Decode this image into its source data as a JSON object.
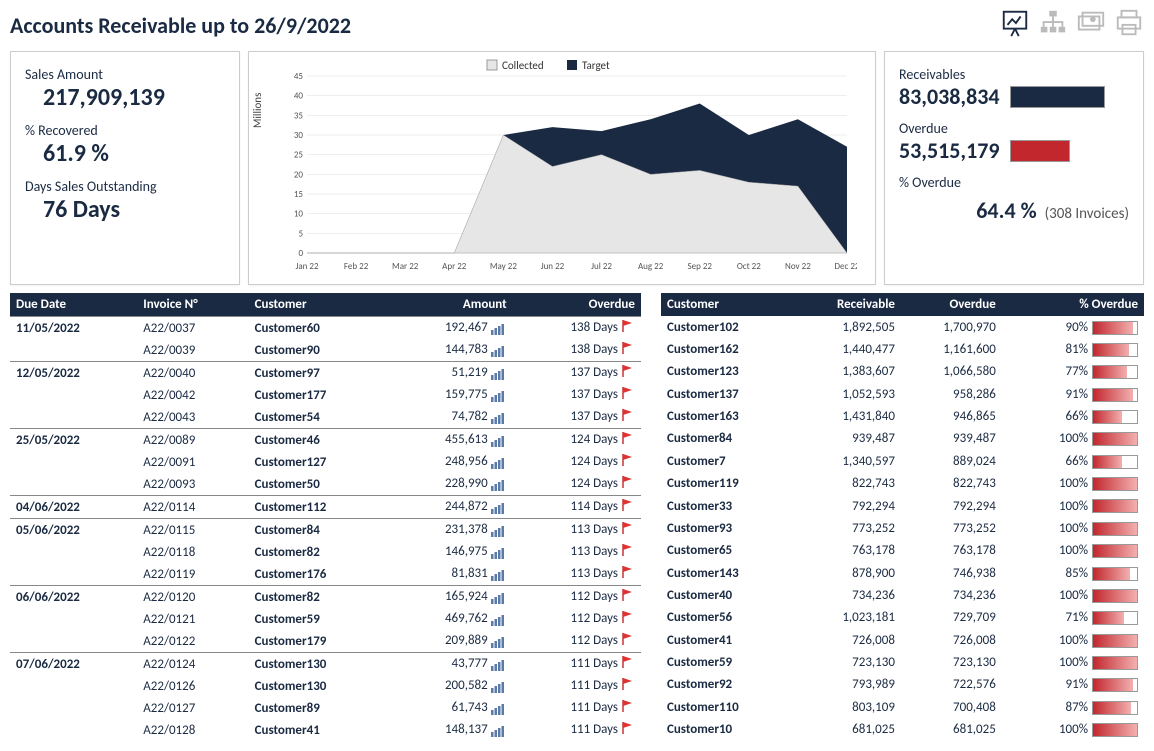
{
  "title": "Accounts Receivable up to 26/9/2022",
  "kpi_left": {
    "sales_label": "Sales Amount",
    "sales_value": "217,909,139",
    "recovered_label": "% Recovered",
    "recovered_value": "61.9 %",
    "dso_label": "Days Sales Outstanding",
    "dso_value": "76 Days"
  },
  "kpi_right": {
    "recv_label": "Receivables",
    "recv_value": "83,038,834",
    "overdue_label": "Overdue",
    "overdue_value": "53,515,179",
    "pct_overdue_label": "% Overdue",
    "pct_overdue_value": "64.4 %",
    "invoices_note": "(308 Invoices)"
  },
  "chart_data": {
    "type": "area",
    "title": "",
    "ylabel": "Millions",
    "xlabel": "",
    "ylim": [
      0,
      45
    ],
    "yticks": [
      0,
      5,
      10,
      15,
      20,
      25,
      30,
      35,
      40,
      45
    ],
    "categories": [
      "Jan 22",
      "Feb 22",
      "Mar 22",
      "Apr 22",
      "May 22",
      "Jun 22",
      "Jul 22",
      "Aug 22",
      "Sep 22",
      "Oct 22",
      "Nov 22",
      "Dec 22"
    ],
    "series": [
      {
        "name": "Collected",
        "color": "#e6e6e6",
        "values": [
          0,
          0,
          0,
          0,
          30,
          22,
          25,
          20,
          21,
          18,
          17,
          0
        ]
      },
      {
        "name": "Target",
        "color": "#1a2a42",
        "values": [
          0,
          0,
          0,
          0,
          30,
          32,
          31,
          34,
          38,
          30,
          34,
          27,
          0
        ]
      }
    ],
    "legend": [
      "Collected",
      "Target"
    ]
  },
  "invoice_table": {
    "headers": [
      "Due Date",
      "Invoice N°",
      "Customer",
      "Amount",
      "Overdue"
    ],
    "rows": [
      {
        "due": "11/05/2022",
        "inv": "A22/0037",
        "cust": "Customer60",
        "amt": "192,467",
        "days": "138 Days",
        "first": true
      },
      {
        "due": "",
        "inv": "A22/0039",
        "cust": "Customer90",
        "amt": "144,783",
        "days": "138 Days"
      },
      {
        "due": "12/05/2022",
        "inv": "A22/0040",
        "cust": "Customer97",
        "amt": "51,219",
        "days": "137 Days",
        "first": true
      },
      {
        "due": "",
        "inv": "A22/0042",
        "cust": "Customer177",
        "amt": "159,775",
        "days": "137 Days"
      },
      {
        "due": "",
        "inv": "A22/0043",
        "cust": "Customer54",
        "amt": "74,782",
        "days": "137 Days"
      },
      {
        "due": "25/05/2022",
        "inv": "A22/0089",
        "cust": "Customer46",
        "amt": "455,613",
        "days": "124 Days",
        "first": true
      },
      {
        "due": "",
        "inv": "A22/0091",
        "cust": "Customer127",
        "amt": "248,956",
        "days": "124 Days"
      },
      {
        "due": "",
        "inv": "A22/0093",
        "cust": "Customer50",
        "amt": "228,990",
        "days": "124 Days"
      },
      {
        "due": "04/06/2022",
        "inv": "A22/0114",
        "cust": "Customer112",
        "amt": "244,872",
        "days": "114 Days",
        "first": true
      },
      {
        "due": "05/06/2022",
        "inv": "A22/0115",
        "cust": "Customer84",
        "amt": "231,378",
        "days": "113 Days",
        "first": true
      },
      {
        "due": "",
        "inv": "A22/0118",
        "cust": "Customer82",
        "amt": "146,975",
        "days": "113 Days"
      },
      {
        "due": "",
        "inv": "A22/0119",
        "cust": "Customer176",
        "amt": "81,831",
        "days": "113 Days"
      },
      {
        "due": "06/06/2022",
        "inv": "A22/0120",
        "cust": "Customer82",
        "amt": "165,924",
        "days": "112 Days",
        "first": true
      },
      {
        "due": "",
        "inv": "A22/0121",
        "cust": "Customer59",
        "amt": "469,762",
        "days": "112 Days"
      },
      {
        "due": "",
        "inv": "A22/0122",
        "cust": "Customer179",
        "amt": "209,889",
        "days": "112 Days"
      },
      {
        "due": "07/06/2022",
        "inv": "A22/0124",
        "cust": "Customer130",
        "amt": "43,777",
        "days": "111 Days",
        "first": true
      },
      {
        "due": "",
        "inv": "A22/0126",
        "cust": "Customer130",
        "amt": "200,582",
        "days": "111 Days"
      },
      {
        "due": "",
        "inv": "A22/0127",
        "cust": "Customer89",
        "amt": "61,743",
        "days": "111 Days"
      },
      {
        "due": "",
        "inv": "A22/0128",
        "cust": "Customer41",
        "amt": "148,137",
        "days": "111 Days"
      }
    ]
  },
  "customer_table": {
    "headers": [
      "Customer",
      "Receivable",
      "Overdue",
      "% Overdue"
    ],
    "rows": [
      {
        "cust": "Customer102",
        "recv": "1,892,505",
        "over": "1,700,970",
        "pct": 90
      },
      {
        "cust": "Customer162",
        "recv": "1,440,477",
        "over": "1,161,600",
        "pct": 81
      },
      {
        "cust": "Customer123",
        "recv": "1,383,607",
        "over": "1,066,580",
        "pct": 77
      },
      {
        "cust": "Customer137",
        "recv": "1,052,593",
        "over": "958,286",
        "pct": 91
      },
      {
        "cust": "Customer163",
        "recv": "1,431,840",
        "over": "946,865",
        "pct": 66
      },
      {
        "cust": "Customer84",
        "recv": "939,487",
        "over": "939,487",
        "pct": 100
      },
      {
        "cust": "Customer7",
        "recv": "1,340,597",
        "over": "889,024",
        "pct": 66
      },
      {
        "cust": "Customer119",
        "recv": "822,743",
        "over": "822,743",
        "pct": 100
      },
      {
        "cust": "Customer33",
        "recv": "792,294",
        "over": "792,294",
        "pct": 100
      },
      {
        "cust": "Customer93",
        "recv": "773,252",
        "over": "773,252",
        "pct": 100
      },
      {
        "cust": "Customer65",
        "recv": "763,178",
        "over": "763,178",
        "pct": 100
      },
      {
        "cust": "Customer143",
        "recv": "878,900",
        "over": "746,938",
        "pct": 85
      },
      {
        "cust": "Customer40",
        "recv": "734,236",
        "over": "734,236",
        "pct": 100
      },
      {
        "cust": "Customer56",
        "recv": "1,023,181",
        "over": "729,709",
        "pct": 71
      },
      {
        "cust": "Customer41",
        "recv": "726,008",
        "over": "726,008",
        "pct": 100
      },
      {
        "cust": "Customer59",
        "recv": "723,130",
        "over": "723,130",
        "pct": 100
      },
      {
        "cust": "Customer92",
        "recv": "793,989",
        "over": "722,576",
        "pct": 91
      },
      {
        "cust": "Customer110",
        "recv": "803,109",
        "over": "700,408",
        "pct": 87
      },
      {
        "cust": "Customer10",
        "recv": "681,025",
        "over": "681,025",
        "pct": 100
      }
    ]
  }
}
